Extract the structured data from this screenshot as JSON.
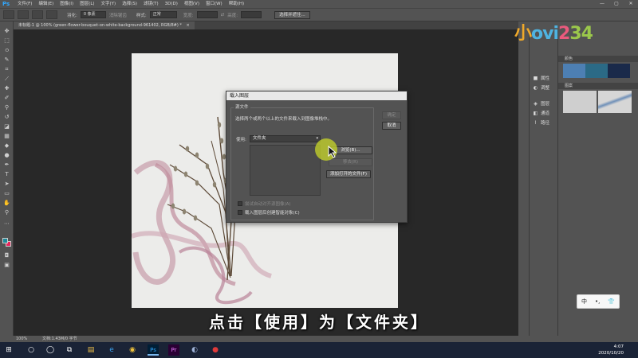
{
  "app": {
    "logo": "Ps",
    "menu": [
      "文件(F)",
      "编辑(E)",
      "图像(I)",
      "图层(L)",
      "文字(Y)",
      "选择(S)",
      "滤镜(T)",
      "3D(D)",
      "视图(V)",
      "窗口(W)",
      "帮助(H)"
    ],
    "window_controls": [
      "—",
      "▢",
      "✕"
    ]
  },
  "options": {
    "feather_label": "羽化:",
    "feather_value": "0 像素",
    "antialias_label": "消除锯齿",
    "style_label": "样式:",
    "style_value": "正常",
    "width_label": "宽度:",
    "height_label": "高度:",
    "select_mask_label": "选择并遮住..."
  },
  "document": {
    "tab_label": "未标题-1 @ 100% (green-flower-bouquet-on-white-background-961402, RGB/8#) *",
    "tab_close": "×"
  },
  "dialog": {
    "title": "载入图层",
    "group_label": "源文件",
    "hint": "选择两个或两个以上的文件来载入到图像堆栈中。",
    "use_label": "使用:",
    "use_value": "文件夹",
    "browse_label": "浏览(B)...",
    "remove_label": "移去(R)",
    "add_open_label": "添加打开的文件(F)",
    "ok_label": "确定",
    "cancel_label": "取消",
    "align_label": "尝试自动对齐源图像(A)",
    "smart_object_label": "载入图层后创建智能对象(C)"
  },
  "panels": {
    "icon_rows": [
      {
        "icon": "■",
        "label": "属性"
      },
      {
        "icon": "◐",
        "label": "调整"
      },
      {
        "icon": "◈",
        "label": "图层"
      },
      {
        "icon": "◧",
        "label": "通道"
      },
      {
        "icon": "⌇",
        "label": "路径"
      }
    ],
    "swatches_head": "颜色",
    "patterns_head": "图案",
    "swatch_colors": [
      "#4d7fb3",
      "#2b6a86",
      "#1a2a4a"
    ]
  },
  "overlay": {
    "logo_parts": [
      "小",
      "ovi",
      "2",
      "34"
    ],
    "subtitle": "点击【使用】为【文件夹】"
  },
  "ime": {
    "items": [
      "中",
      "•,",
      "👕"
    ]
  },
  "status": {
    "zoom": "100%",
    "doc_size": "文档:1.43M/0 字节"
  },
  "taskbar": {
    "icons": [
      "⊞",
      "○",
      "◯",
      "⧉",
      "▤",
      "e",
      "◉",
      "Ps",
      "Pr",
      "◐",
      "●"
    ],
    "time": "4:07",
    "date": "2020/10/20"
  }
}
